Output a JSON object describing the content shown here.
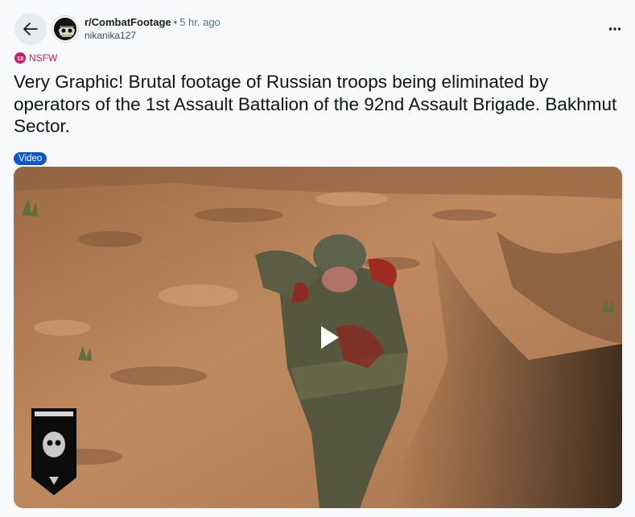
{
  "header": {
    "subreddit": "r/CombatFootage",
    "separator": "•",
    "time": "5 hr. ago",
    "author": "nikanika127"
  },
  "post": {
    "nsfw_badge": "18",
    "nsfw_label": "NSFW",
    "title": "Very Graphic! Brutal footage of Russian troops being eliminated by operators of the 1st Assault Battalion of the 92nd Assault Brigade. Bakhmut Sector.",
    "flair": "Video"
  },
  "icons": {
    "back": "arrow-left-icon",
    "more": "more-horizontal-icon",
    "play": "play-icon"
  },
  "colors": {
    "nsfw": "#d4196c",
    "flair": "#0a58d0"
  }
}
